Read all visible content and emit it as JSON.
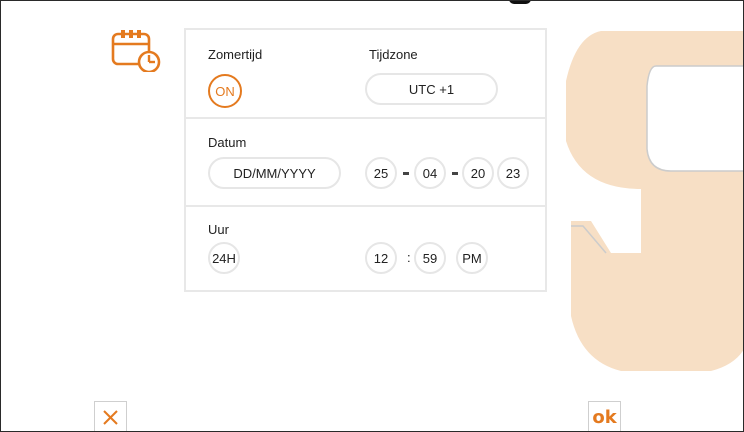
{
  "colors": {
    "accent": "#e47a1f",
    "watermark": "#f7dfc5"
  },
  "icons": {
    "calendar": "calendar-clock-icon",
    "cancel": "close-icon",
    "brand": "brand-watermark"
  },
  "summertime": {
    "label": "Zomertijd",
    "toggle_value": "ON"
  },
  "timezone": {
    "label": "Tijdzone",
    "value": "UTC +1"
  },
  "date": {
    "label": "Datum",
    "format": "DD/MM/YYYY",
    "day": "25",
    "month": "04",
    "year_century": "20",
    "year": "23"
  },
  "time": {
    "label": "Uur",
    "format": "24H",
    "hour": "12",
    "separator": ":",
    "minute": "59",
    "ampm": "PM"
  },
  "footer": {
    "ok_label": "ok"
  }
}
